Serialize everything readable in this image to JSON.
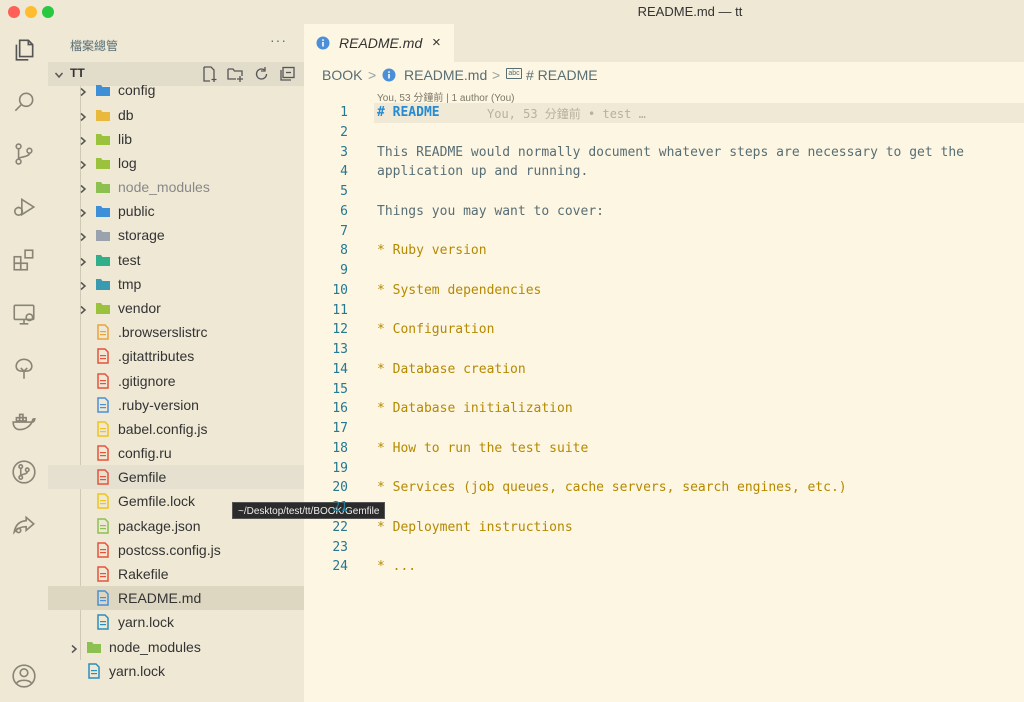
{
  "window": {
    "title": "README.md — tt"
  },
  "colors": {
    "close": "#ff5f57",
    "minimize": "#febc2e",
    "maximize": "#28c840",
    "accent": "#268bd2"
  },
  "activity_bar": [
    "explorer-icon",
    "search-icon",
    "source-control-icon",
    "run-debug-icon",
    "extensions-icon",
    "remote-explorer-icon",
    "tree-icon",
    "docker-icon",
    "git-graph-icon",
    "live-share-icon",
    "account-icon"
  ],
  "sidebar": {
    "title": "檔案總管",
    "more": "···",
    "root": "TT",
    "items": [
      {
        "name": "config",
        "kind": "folder",
        "icon_color": "#3d8fd8"
      },
      {
        "name": "db",
        "kind": "folder",
        "icon_color": "#e8b93c"
      },
      {
        "name": "lib",
        "kind": "folder",
        "icon_color": "#9bc23c"
      },
      {
        "name": "log",
        "kind": "folder",
        "icon_color": "#9bc23c"
      },
      {
        "name": "node_modules",
        "kind": "folder",
        "icon_color": "#8cc152"
      },
      {
        "name": "public",
        "kind": "folder",
        "icon_color": "#3d8fd8"
      },
      {
        "name": "storage",
        "kind": "folder",
        "icon_color": "#9aa3ad"
      },
      {
        "name": "test",
        "kind": "folder",
        "icon_color": "#2fb08a"
      },
      {
        "name": "tmp",
        "kind": "folder",
        "icon_color": "#3a9bb0"
      },
      {
        "name": "vendor",
        "kind": "folder",
        "icon_color": "#9bc23c"
      },
      {
        "name": ".browserslistrc",
        "kind": "file",
        "icon_color": "#e8a33c"
      },
      {
        "name": ".gitattributes",
        "kind": "file",
        "icon_color": "#e5533c"
      },
      {
        "name": ".gitignore",
        "kind": "file",
        "icon_color": "#e5533c"
      },
      {
        "name": ".ruby-version",
        "kind": "file",
        "icon_color": "#4a8fd8"
      },
      {
        "name": "babel.config.js",
        "kind": "file",
        "icon_color": "#f0c419"
      },
      {
        "name": "config.ru",
        "kind": "file",
        "icon_color": "#e5533c"
      },
      {
        "name": "Gemfile",
        "kind": "file",
        "icon_color": "#e5533c"
      },
      {
        "name": "Gemfile.lock",
        "kind": "file",
        "icon_color": "#f0c419"
      },
      {
        "name": "package.json",
        "kind": "file",
        "icon_color": "#8cc152"
      },
      {
        "name": "postcss.config.js",
        "kind": "file",
        "icon_color": "#e5533c"
      },
      {
        "name": "Rakefile",
        "kind": "file",
        "icon_color": "#e5533c"
      },
      {
        "name": "README.md",
        "kind": "file",
        "icon_color": "#4a8fd8"
      },
      {
        "name": "yarn.lock",
        "kind": "file",
        "icon_color": "#2c8ebb"
      },
      {
        "name": "node_modules",
        "kind": "folder",
        "icon_color": "#8cc152"
      },
      {
        "name": "yarn.lock",
        "kind": "file",
        "icon_color": "#2c8ebb"
      }
    ],
    "tooltip": "~/Desktop/test/tt/BOOK/Gemfile"
  },
  "editor": {
    "tab_label": "README.md",
    "tab_close": "×",
    "breadcrumb": {
      "folder": "BOOK",
      "file": "README.md",
      "symbol": "# README",
      "sep": ">",
      "symbol_icon": "abc"
    },
    "blame_header": "You, 53 分鐘前 | 1 author (You)",
    "inline_blame": "You, 53 分鐘前 • test …",
    "lines": [
      {
        "n": "1",
        "text": "# README",
        "style": "heading"
      },
      {
        "n": "2",
        "text": "",
        "style": "plain"
      },
      {
        "n": "3",
        "text": "This README would normally document whatever steps are necessary to get the",
        "style": "plain"
      },
      {
        "n": "4",
        "text": "application up and running.",
        "style": "plain"
      },
      {
        "n": "5",
        "text": "",
        "style": "plain"
      },
      {
        "n": "6",
        "text": "Things you may want to cover:",
        "style": "plain"
      },
      {
        "n": "7",
        "text": "",
        "style": "plain"
      },
      {
        "n": "8",
        "text": "* Ruby version",
        "style": "bullet"
      },
      {
        "n": "9",
        "text": "",
        "style": "plain"
      },
      {
        "n": "10",
        "text": "* System dependencies",
        "style": "bullet"
      },
      {
        "n": "11",
        "text": "",
        "style": "plain"
      },
      {
        "n": "12",
        "text": "* Configuration",
        "style": "bullet"
      },
      {
        "n": "13",
        "text": "",
        "style": "plain"
      },
      {
        "n": "14",
        "text": "* Database creation",
        "style": "bullet"
      },
      {
        "n": "15",
        "text": "",
        "style": "plain"
      },
      {
        "n": "16",
        "text": "* Database initialization",
        "style": "bullet"
      },
      {
        "n": "17",
        "text": "",
        "style": "plain"
      },
      {
        "n": "18",
        "text": "* How to run the test suite",
        "style": "bullet"
      },
      {
        "n": "19",
        "text": "",
        "style": "plain"
      },
      {
        "n": "20",
        "text": "* Services (job queues, cache servers, search engines, etc.)",
        "style": "bullet"
      },
      {
        "n": "21",
        "text": "",
        "style": "plain"
      },
      {
        "n": "22",
        "text": "* Deployment instructions",
        "style": "bullet"
      },
      {
        "n": "23",
        "text": "",
        "style": "plain"
      },
      {
        "n": "24",
        "text": "* ...",
        "style": "bullet"
      }
    ]
  }
}
